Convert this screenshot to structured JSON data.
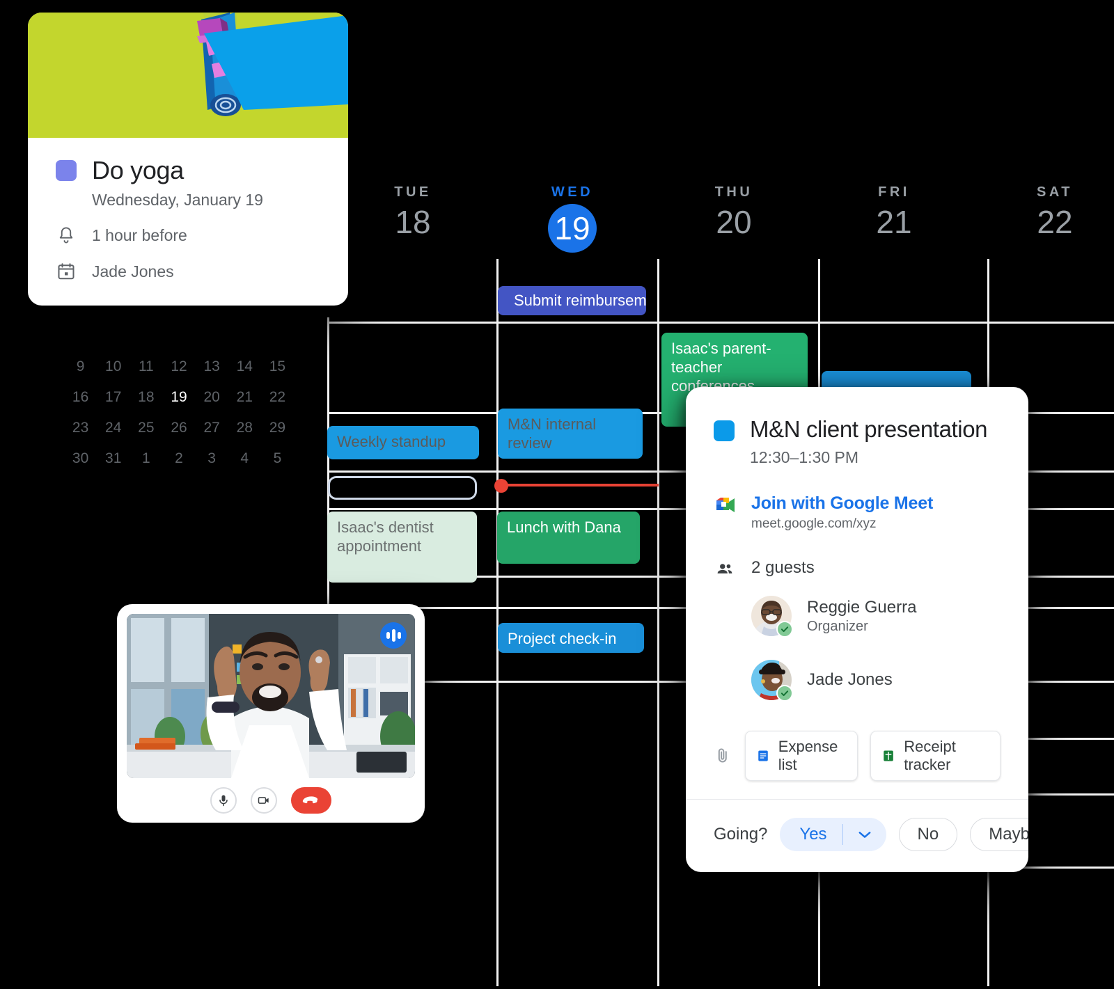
{
  "week_header": {
    "days": [
      {
        "dow": "TUE",
        "num": "18",
        "today": false
      },
      {
        "dow": "WED",
        "num": "19",
        "today": true
      },
      {
        "dow": "THU",
        "num": "20",
        "today": false
      },
      {
        "dow": "FRI",
        "num": "21",
        "today": false
      },
      {
        "dow": "SAT",
        "num": "22",
        "today": false
      }
    ]
  },
  "mini_month": {
    "selected": "19",
    "rows": [
      [
        "9",
        "10",
        "11",
        "12",
        "13",
        "14",
        "15"
      ],
      [
        "16",
        "17",
        "18",
        "19",
        "20",
        "21",
        "22"
      ],
      [
        "23",
        "24",
        "25",
        "26",
        "27",
        "28",
        "29"
      ],
      [
        "30",
        "31",
        "1",
        "2",
        "3",
        "4",
        "5"
      ]
    ]
  },
  "events": {
    "submit_reimbursement": "Submit reimbursement",
    "parent_teacher": "Isaac's parent-teacher conferences",
    "weekly_standup": "Weekly standup",
    "mn_internal_review": "M&N internal review",
    "isaacs_dentist": "Isaac's dentist appointment",
    "lunch_with_dana": "Lunch with Dana",
    "project_check_in": "Project check-in"
  },
  "yoga_card": {
    "title": "Do yoga",
    "date": "Wednesday, January 19",
    "reminder": "1 hour before",
    "calendar": "Jade Jones",
    "color": "#7b83eb"
  },
  "event_popup": {
    "title": "M&N client presentation",
    "time": "12:30–1:30 PM",
    "color": "#0b9ae9",
    "meet_link_label": "Join with Google Meet",
    "meet_url": "meet.google.com/xyz",
    "guests_count": "2 guests",
    "guests": [
      {
        "name": "Reggie Guerra",
        "role": "Organizer",
        "accepted": true
      },
      {
        "name": "Jade Jones",
        "role": "",
        "accepted": true
      }
    ],
    "attachments": [
      {
        "label": "Expense list",
        "icon": "google-docs-icon"
      },
      {
        "label": "Receipt tracker",
        "icon": "google-sheets-icon"
      }
    ],
    "rsvp_prompt": "Going?",
    "rsvp_options": [
      "Yes",
      "No",
      "Maybe"
    ],
    "rsvp_selected": "Yes"
  },
  "meet_window": {
    "controls": [
      "microphone-icon",
      "camera-icon",
      "hangup-icon"
    ]
  },
  "colors": {
    "accent_blue": "#1a73e8",
    "event_blue": "#1a9ae1",
    "event_green": "#25a568",
    "event_purple": "#4355c4",
    "event_mint": "#d9ece0",
    "now_red": "#ea4335",
    "grid_line": "#f2f2f2"
  }
}
